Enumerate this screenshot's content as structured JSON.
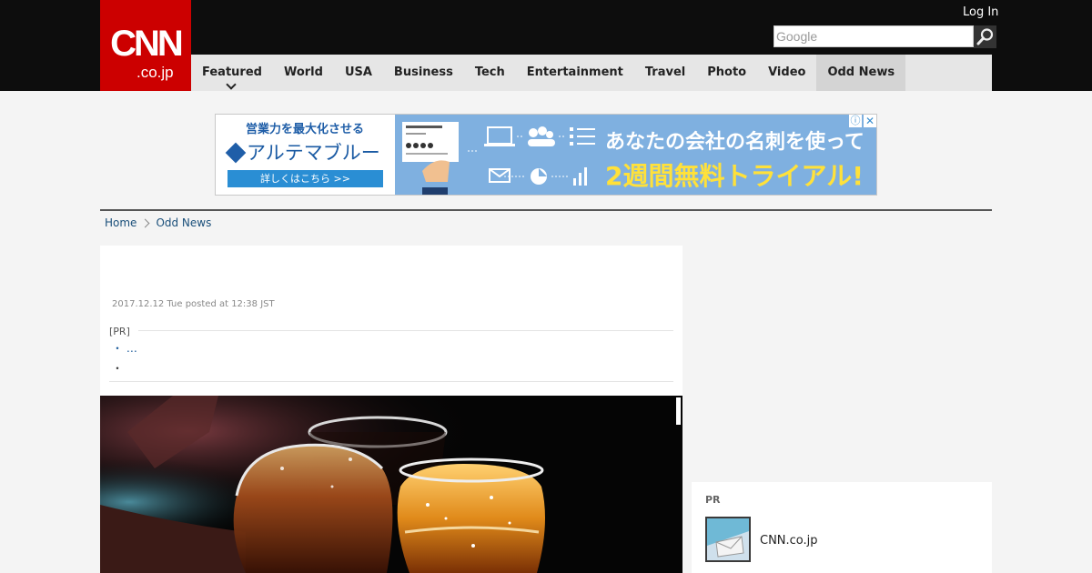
{
  "header": {
    "logo_main": "CNN",
    "logo_sub": ".co.jp",
    "login_label": "Log In",
    "search_placeholder": "Google"
  },
  "nav": {
    "items": [
      "Featured",
      "World",
      "USA",
      "Business",
      "Tech",
      "Entertainment",
      "Travel",
      "Photo",
      "Video",
      "Odd News"
    ],
    "active": "Odd News"
  },
  "ad": {
    "tagline": "営業力を最大化させる",
    "brand": "アルテマブルー",
    "cta": "詳しくはこちら >>",
    "headline": "あなたの会社の名刺を使って",
    "offer": "2週間無料トライアル!",
    "info_icon": "ⓘ",
    "close_icon": "✕"
  },
  "breadcrumb": {
    "home": "Home",
    "current": "Odd News"
  },
  "article": {
    "posted": "2017.12.12 Tue posted at 12:38 JST",
    "pr_label": "[PR]",
    "pr_items": [
      "・ …",
      "・"
    ]
  },
  "sidebar": {
    "pr_label": "PR",
    "item_title": "CNN.co.jp"
  },
  "colors": {
    "brand_red": "#cc0000",
    "header_black": "#0d0d0d",
    "link_blue": "#1a4f7a"
  }
}
